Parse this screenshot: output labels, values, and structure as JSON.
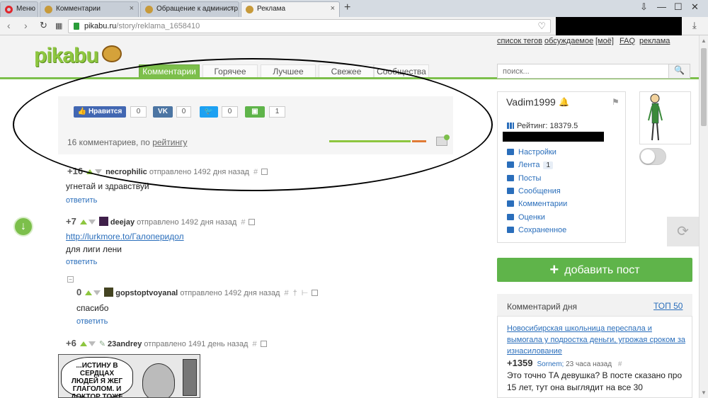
{
  "browser": {
    "tabs": [
      {
        "label": "Меню",
        "icon": "opera-icon",
        "close": ""
      },
      {
        "label": "Комментарии",
        "icon": "pikabu-favicon",
        "close": "×"
      },
      {
        "label": "Обращение к администр...",
        "icon": "pikabu-favicon",
        "close": "×"
      },
      {
        "label": "Реклама",
        "icon": "pikabu-favicon",
        "close": "×"
      }
    ],
    "new_tab": "+",
    "url_host": "pikabu.ru",
    "url_path": "/story/reklama_1658410"
  },
  "header": {
    "logo": "pikabu",
    "top_links": [
      "список тегов",
      "обсуждаемое",
      "[моё]",
      "FAQ",
      "реклама"
    ],
    "nav_tabs": [
      "Комментарии",
      "Горячее",
      "Лучшее",
      "Свежее",
      "Сообщества"
    ],
    "search_placeholder": "поиск..."
  },
  "share": {
    "like_label": "Нравится",
    "like_count": "0",
    "vk_label": "VK",
    "vk_count": "0",
    "tw_count": "0",
    "save_count": "1",
    "comments_prefix": "16 комментариев, по ",
    "comments_sort": "рейтингу"
  },
  "comments": [
    {
      "score": "+16",
      "user": "necrophilic",
      "meta": "отправлено 1492 дня назад",
      "text": "угнетай и здравствуй",
      "reply": "ответить"
    },
    {
      "score": "+7",
      "user": "deejay",
      "meta": "отправлено 1492 дня назад",
      "link": "http://lurkmore.to/Галоперидол",
      "text": "для лиги лени",
      "reply": "ответить"
    },
    {
      "score": "0",
      "user": "gopstoptvoyanal",
      "meta": "отправлено 1492 дня назад",
      "text": "спасибо",
      "reply": "ответить"
    },
    {
      "score": "+6",
      "user": "23andrey",
      "meta": "отправлено 1491 день назад"
    }
  ],
  "comic_text": "...ИСТИНУ В СЕРДЦАХ ЛЮДЕЙ Я ЖЕГ ГЛАГОЛОМ. И ДОКТОР ТОЖЕ ХГЁТ. НО ГАЛАПЕРИДО...",
  "sidebar": {
    "username": "Vadim1999",
    "rating": "Рейтинг: 18379.5",
    "menu": [
      {
        "label": "Настройки",
        "icon": "gear-icon"
      },
      {
        "label": "Лента",
        "icon": "feed-icon",
        "badge": "1"
      },
      {
        "label": "Посты",
        "icon": "posts-icon"
      },
      {
        "label": "Сообщения",
        "icon": "mail-icon"
      },
      {
        "label": "Комментарии",
        "icon": "comments-icon"
      },
      {
        "label": "Оценки",
        "icon": "ratings-icon"
      },
      {
        "label": "Сохраненное",
        "icon": "saved-icon"
      }
    ],
    "add_post": "добавить пост",
    "cotd_title": "Комментарий дня",
    "cotd_top": "ТОП 50",
    "cotd_link": "Новосибирская школьница переспала и вымогала у подростка деньги, угрожая сроком за изнасилование",
    "cotd_score": "+1359",
    "cotd_author": "Sornem;",
    "cotd_time": "23 часа назад",
    "cotd_hash": "#",
    "cotd_text": "Это точно ТА девушка? В посте сказано про 15 лет, тут она выглядит на все 30"
  },
  "colors": {
    "accent": "#7cbf4b",
    "link": "#2a6ebb"
  }
}
